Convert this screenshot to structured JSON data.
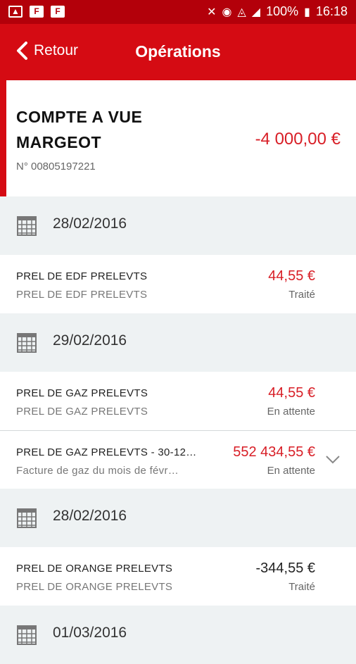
{
  "statusbar": {
    "battery": "100%",
    "time": "16:18"
  },
  "appbar": {
    "back_label": "Retour",
    "title": "Opérations"
  },
  "account": {
    "name": "COMPTE A VUE MARGEOT",
    "number": "N° 00805197221",
    "balance": "-4 000,00 €"
  },
  "sections": [
    {
      "date": "28/02/2016",
      "operations": [
        {
          "label": "PREL DE EDF PRELEVTS",
          "sublabel": "PREL DE EDF PRELEVTS",
          "amount": "44,55 €",
          "status": "Traité"
        }
      ]
    },
    {
      "date": "29/02/2016",
      "operations": [
        {
          "label": "PREL DE GAZ PRELEVTS",
          "sublabel": "PREL DE GAZ PRELEVTS",
          "amount": "44,55 €",
          "status": "En attente"
        },
        {
          "label": "PREL DE GAZ PRELEVTS - 30-12…",
          "sublabel": "Facture de gaz du mois de févr…",
          "amount": "552 434,55 €",
          "status": "En attente"
        }
      ]
    },
    {
      "date": "28/02/2016",
      "operations": [
        {
          "label": "PREL DE ORANGE PRELEVTS",
          "sublabel": "PREL DE ORANGE PRELEVTS",
          "amount": "-344,55 €",
          "status": "Traité"
        }
      ]
    },
    {
      "date": "01/03/2016"
    }
  ],
  "colors": {
    "brand": "#d50b13",
    "amount_red": "#d81e26"
  },
  "icons": [
    "calendar-icon",
    "chevron-down-icon",
    "back-chevron-icon"
  ]
}
